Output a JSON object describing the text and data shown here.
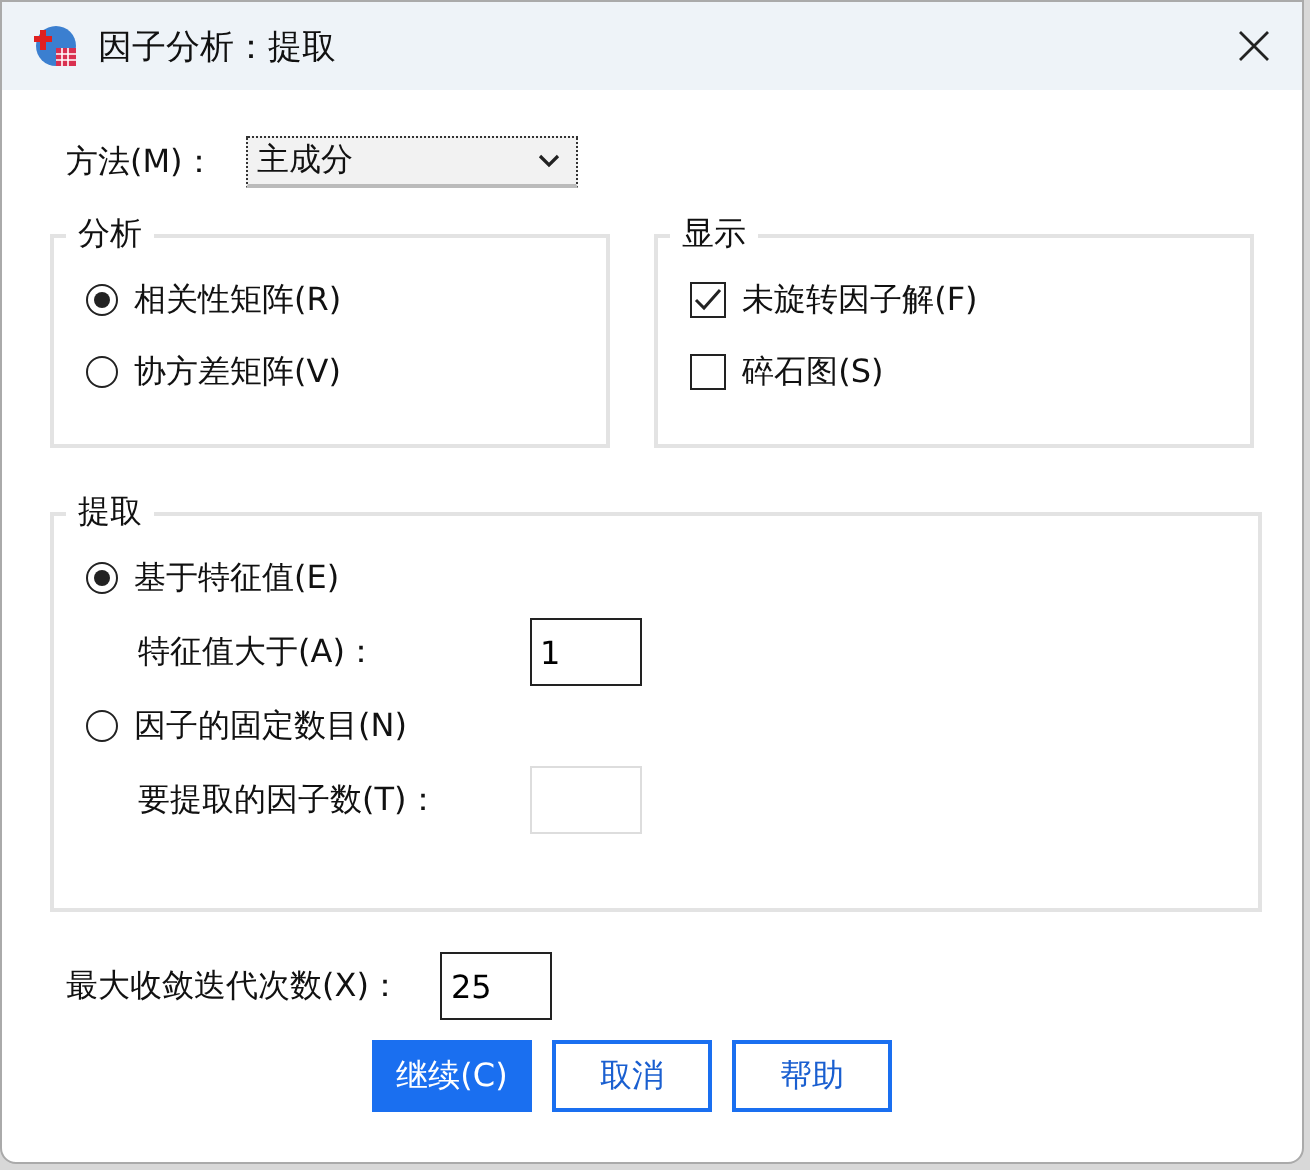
{
  "window": {
    "title": "因子分析：提取"
  },
  "method": {
    "label": "方法(M)：",
    "value": "主成分"
  },
  "analysis": {
    "title": "分析",
    "options": [
      {
        "label": "相关性矩阵(R)",
        "selected": true
      },
      {
        "label": "协方差矩阵(V)",
        "selected": false
      }
    ]
  },
  "display": {
    "title": "显示",
    "options": [
      {
        "label": "未旋转因子解(F)",
        "checked": true
      },
      {
        "label": "碎石图(S)",
        "checked": false
      }
    ]
  },
  "extraction": {
    "title": "提取",
    "options": [
      {
        "label": "基于特征值(E)",
        "selected": true,
        "field_label": "特征值大于(A)：",
        "field_value": "1",
        "field_disabled": false
      },
      {
        "label": "因子的固定数目(N)",
        "selected": false,
        "field_label": "要提取的因子数(T)：",
        "field_disabled": true
      }
    ]
  },
  "max_iterations": {
    "label": "最大收敛迭代次数(X)：",
    "value": "25"
  },
  "buttons": [
    {
      "label": "继续(C)",
      "kind": "primary"
    },
    {
      "label": "取消",
      "kind": "secondary"
    },
    {
      "label": "帮助",
      "kind": "secondary"
    }
  ]
}
